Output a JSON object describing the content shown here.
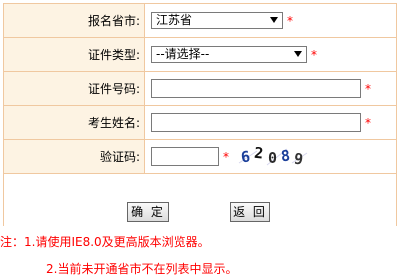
{
  "form": {
    "province": {
      "label": "报名省市:",
      "value": "江苏省",
      "required": "*"
    },
    "id_type": {
      "label": "证件类型:",
      "value": "--请选择--",
      "required": "*"
    },
    "id_number": {
      "label": "证件号码:",
      "value": "",
      "required": "*"
    },
    "name": {
      "label": "考生姓名:",
      "value": "",
      "required": "*"
    },
    "captcha": {
      "label": "验证码:",
      "value": "",
      "required": "*",
      "image_text": "62089"
    }
  },
  "buttons": {
    "confirm": "确 定",
    "back": "返 回"
  },
  "notes": {
    "line1": "注：1.请使用IE8.0及更高版本浏览器。",
    "line2": "2.当前未开通省市不在列表中显示。"
  },
  "colors": {
    "label_bg": "#fdf3e3",
    "border": "#f0c8a0",
    "required": "#ff0000"
  }
}
